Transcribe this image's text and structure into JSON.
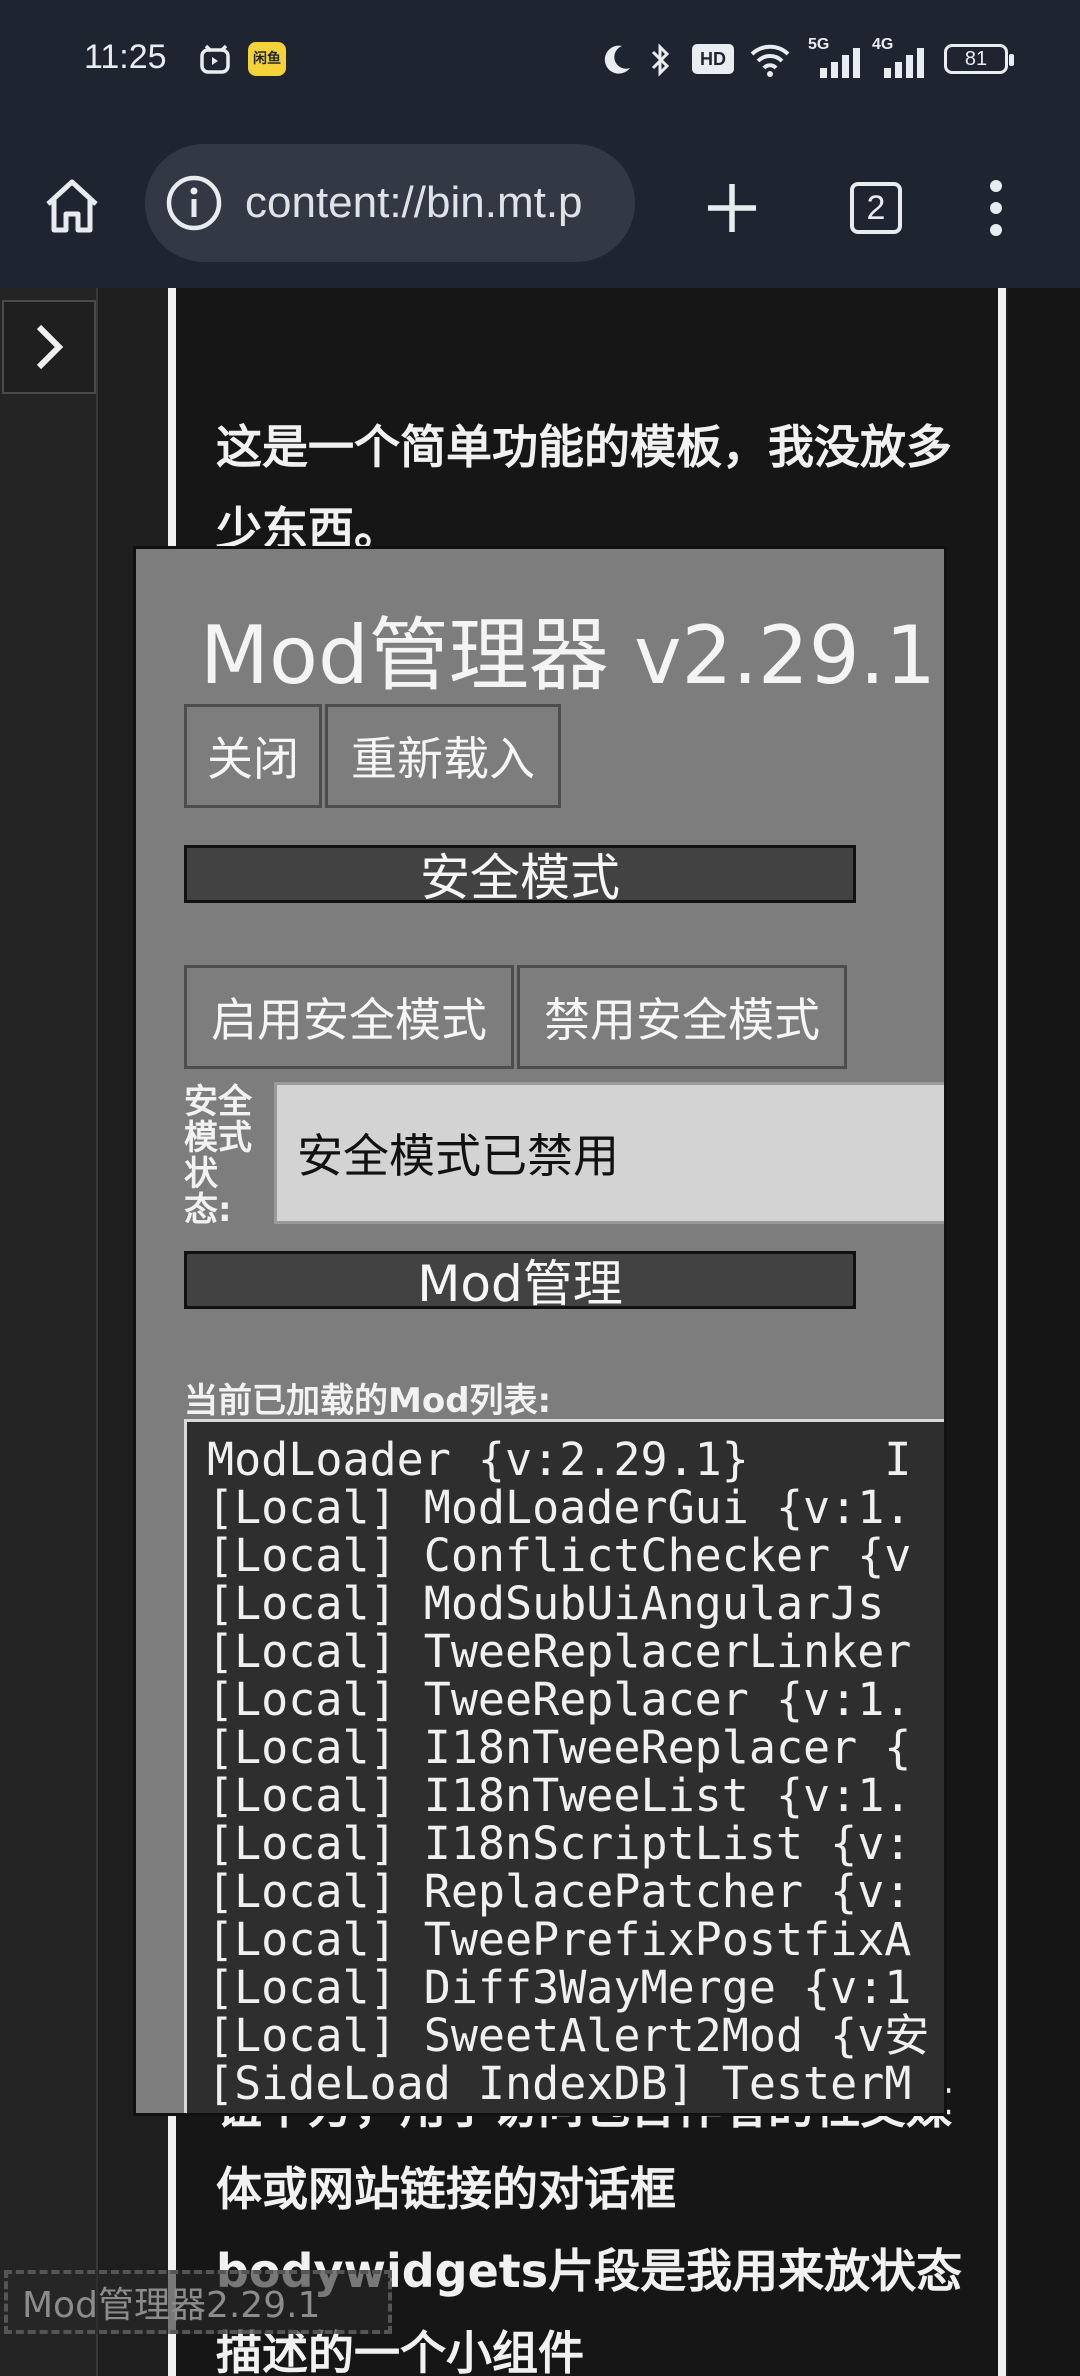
{
  "status_bar": {
    "time": "11:25",
    "battery": "81",
    "icons": [
      "alarm-icon",
      "app-badge-icon",
      "moon-icon",
      "bluetooth-icon",
      "hd-icon",
      "wifi-icon",
      "5g-signal-icon",
      "4g-signal-icon",
      "battery-icon"
    ],
    "app_badge_text": "闲鱼",
    "hd_text": "HD",
    "net1": "5G",
    "net2": "4G"
  },
  "browser": {
    "url": "content://bin.mt.p",
    "tab_count": "2"
  },
  "page": {
    "para_top": "这是一个简单功能的模板，我没放多少东西。",
    "para_mid": "钮下方，用于访问包含作者的社交媒体或网站链接的对话框",
    "para_bottom": "bodywidgets片段是我用来放状态描述的一个小组件"
  },
  "dialog": {
    "title": "Mod管理器 v2.29.1",
    "close_label": "关闭",
    "reload_label": "重新载入",
    "safe_mode_section": "安全模式",
    "enable_safe_label": "启用安全模式",
    "disable_safe_label": "禁用安全模式",
    "safe_status_label": "安全模式状态:",
    "safe_status_value": "安全模式已禁用",
    "mod_section": "Mod管理",
    "loaded_list_label": "当前已加载的Mod列表:",
    "mods": [
      "ModLoader {v:2.29.1}     I",
      "[Local] ModLoaderGui {v:1.",
      "[Local] ConflictChecker {v",
      "[Local] ModSubUiAngularJs ",
      "[Local] TweeReplacerLinker",
      "[Local] TweeReplacer {v:1.",
      "[Local] I18nTweeReplacer {",
      "[Local] I18nTweeList {v:1.",
      "[Local] I18nScriptList {v:",
      "[Local] ReplacePatcher {v:",
      "[Local] TweePrefixPostfixA",
      "[Local] Diff3WayMerge {v:1",
      "[Local] SweetAlert2Mod {v安",
      "[SideLoad IndexDB] TesterM"
    ]
  },
  "floating_label": "Mod管理器2.29.1"
}
